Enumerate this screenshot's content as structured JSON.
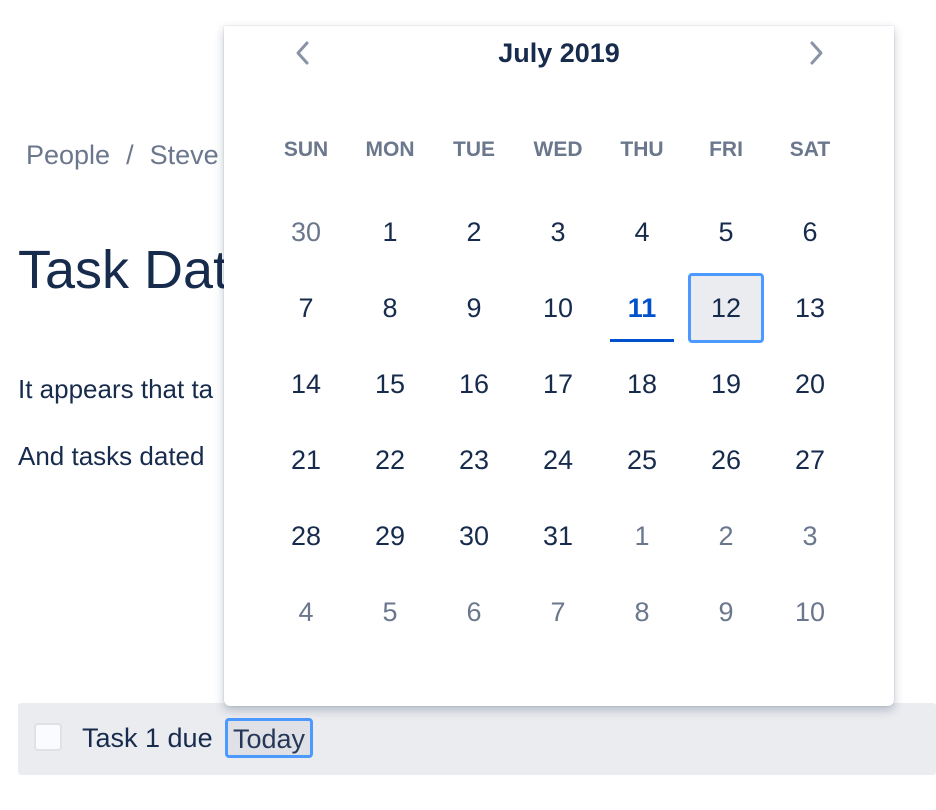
{
  "breadcrumb": {
    "items": [
      "People",
      "Steve"
    ],
    "separator": "/"
  },
  "page": {
    "title": "Task Dat",
    "paragraphs": [
      "It appears that ta",
      "And tasks dated"
    ]
  },
  "task": {
    "label": "Task 1 due",
    "date": "Today"
  },
  "calendar": {
    "month_label": "July 2019",
    "prev_icon": "chevron-left-icon",
    "next_icon": "chevron-right-icon",
    "weekdays": [
      "SUN",
      "MON",
      "TUE",
      "WED",
      "THU",
      "FRI",
      "SAT"
    ],
    "weeks": [
      [
        "30",
        "1",
        "2",
        "3",
        "4",
        "5",
        "6"
      ],
      [
        "7",
        "8",
        "9",
        "10",
        "11",
        "12",
        "13"
      ],
      [
        "14",
        "15",
        "16",
        "17",
        "18",
        "19",
        "20"
      ],
      [
        "21",
        "22",
        "23",
        "24",
        "25",
        "26",
        "27"
      ],
      [
        "28",
        "29",
        "30",
        "31",
        "1",
        "2",
        "3"
      ],
      [
        "4",
        "5",
        "6",
        "7",
        "8",
        "9",
        "10"
      ]
    ],
    "today": "11",
    "selected": "12"
  },
  "colors": {
    "accent": "#0052cc",
    "focus_ring": "#4c9aff",
    "text": "#172b4d",
    "muted": "#6b778c"
  }
}
